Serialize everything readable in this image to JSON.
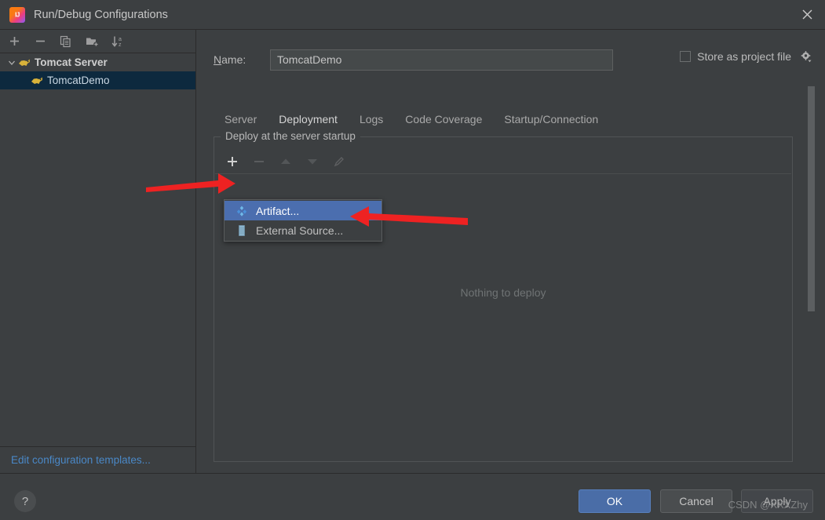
{
  "window": {
    "title": "Run/Debug Configurations",
    "app_icon": "intellij-idea-icon",
    "close_icon": "close-icon"
  },
  "left_panel": {
    "toolbar": [
      {
        "name": "add-configuration-button",
        "icon": "plus-icon"
      },
      {
        "name": "remove-configuration-button",
        "icon": "minus-icon"
      },
      {
        "name": "copy-configuration-button",
        "icon": "copy-icon"
      },
      {
        "name": "new-folder-button",
        "icon": "folder-add-icon"
      },
      {
        "name": "sort-configurations-button",
        "icon": "sort-az-icon"
      }
    ],
    "tree": [
      {
        "label": "Tomcat Server",
        "type": "group",
        "expanded": true,
        "icon": "tomcat-icon",
        "selected": false
      },
      {
        "label": "TomcatDemo",
        "type": "item",
        "icon": "tomcat-icon",
        "selected": true
      }
    ],
    "edit_templates_link": "Edit configuration templates..."
  },
  "main": {
    "name_label": "Name:",
    "name_label_mnemonic": "N",
    "name_value": "TomcatDemo",
    "name_placeholder": "",
    "store_as_project_file": {
      "label": "Store as project file",
      "checked": false,
      "gear_icon": "gear-icon"
    },
    "tabs": [
      {
        "label": "Server",
        "active": false
      },
      {
        "label": "Deployment",
        "active": true
      },
      {
        "label": "Logs",
        "active": false
      },
      {
        "label": "Code Coverage",
        "active": false
      },
      {
        "label": "Startup/Connection",
        "active": false
      }
    ],
    "deploy_group": {
      "title": "Deploy at the server startup",
      "toolbar": [
        {
          "name": "add-deployment-button",
          "icon": "plus-icon",
          "enabled": true
        },
        {
          "name": "remove-deployment-button",
          "icon": "minus-icon",
          "enabled": false
        },
        {
          "name": "move-up-button",
          "icon": "arrow-up-icon",
          "enabled": false
        },
        {
          "name": "move-down-button",
          "icon": "arrow-down-icon",
          "enabled": false
        },
        {
          "name": "edit-deployment-button",
          "icon": "pencil-icon",
          "enabled": false
        }
      ],
      "empty_text": "Nothing to deploy"
    },
    "popup_menu": [
      {
        "label": "Artifact...",
        "icon": "artifact-icon",
        "selected": true
      },
      {
        "label": "External Source...",
        "icon": "external-source-icon",
        "selected": false
      }
    ]
  },
  "bottom": {
    "help_label": "?",
    "ok_label": "OK",
    "cancel_label": "Cancel",
    "apply_label": "Apply"
  },
  "watermark": "CSDN @XXXZhy",
  "colors": {
    "background": "#3c3f41",
    "accent_blue": "#4a88c7",
    "selection_blue": "#4b6eaf",
    "tree_selection": "#0d293e",
    "link_blue": "#4a88c7",
    "arrow_red": "#ee2222",
    "ok_button": "#4a6da7"
  }
}
